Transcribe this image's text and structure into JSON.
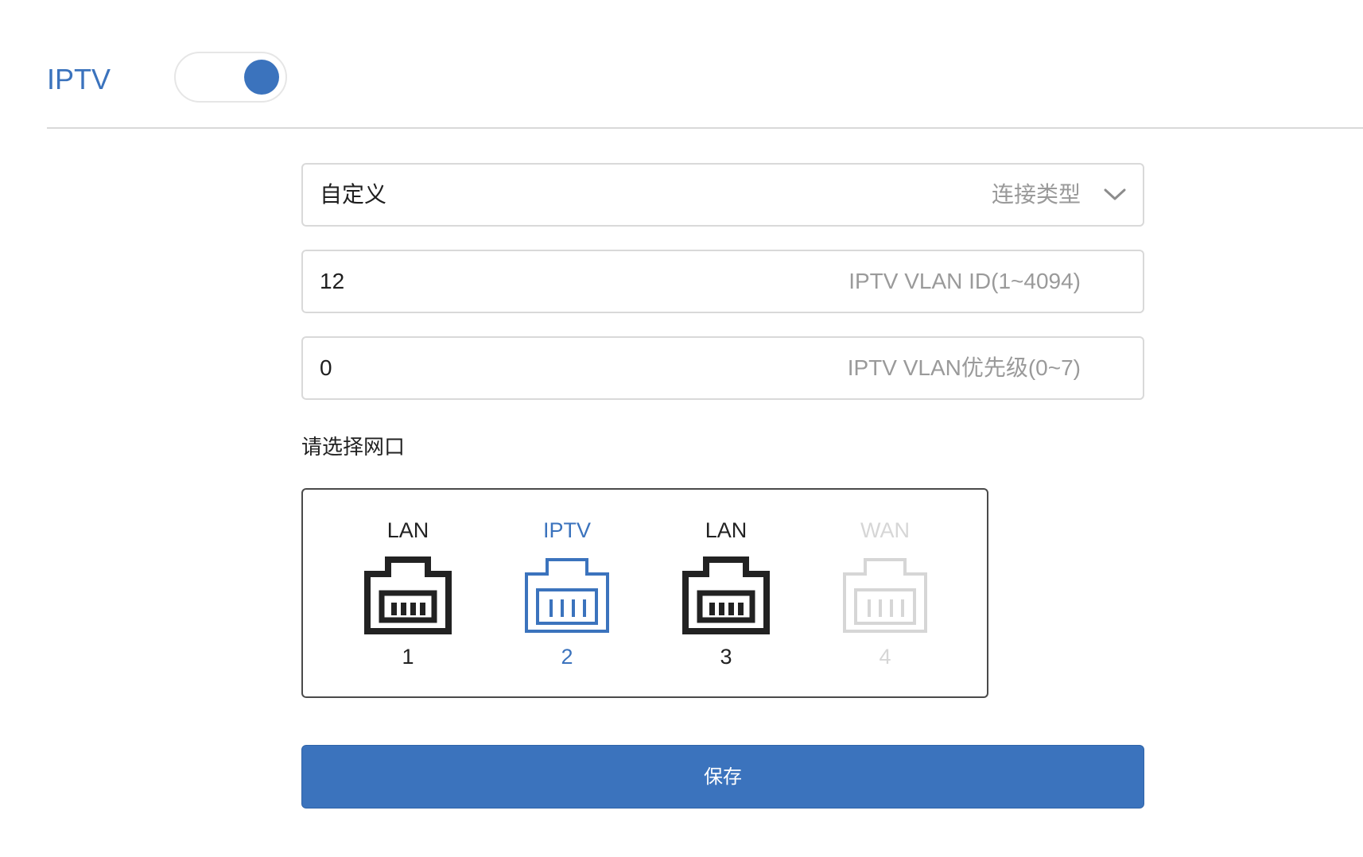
{
  "colors": {
    "accent": "#3b73bd",
    "active_port": "#3b73bd",
    "enabled_port": "#222222",
    "disabled_port": "#d6d6d6"
  },
  "header": {
    "title": "IPTV",
    "toggle_on": true
  },
  "form": {
    "connection_type": {
      "value": "自定义",
      "label": "连接类型",
      "icon": "chevron-down-icon"
    },
    "vlan_id": {
      "value": "12",
      "label": "IPTV VLAN ID(1~4094)"
    },
    "vlan_priority": {
      "value": "0",
      "label": "IPTV VLAN优先级(0~7)"
    }
  },
  "ports_section": {
    "label": "请选择网口",
    "ports": [
      {
        "name": "LAN",
        "number": "1",
        "state": "enabled",
        "icon": "ethernet-port-icon"
      },
      {
        "name": "IPTV",
        "number": "2",
        "state": "selected",
        "icon": "ethernet-port-icon"
      },
      {
        "name": "LAN",
        "number": "3",
        "state": "enabled",
        "icon": "ethernet-port-icon"
      },
      {
        "name": "WAN",
        "number": "4",
        "state": "disabled",
        "icon": "ethernet-port-icon"
      }
    ]
  },
  "actions": {
    "save_label": "保存"
  }
}
